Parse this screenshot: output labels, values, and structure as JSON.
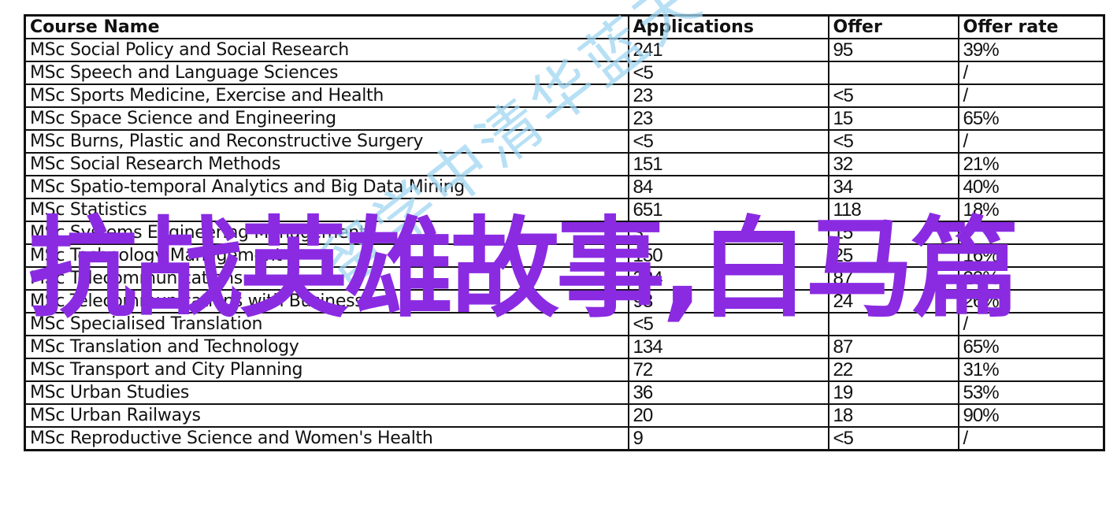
{
  "overlay": {
    "title": "抗战英雄故事,白马篇",
    "color": "#8a2be2"
  },
  "watermark": {
    "text": "留学中清华蓝天地",
    "color": "#9fd6f2"
  },
  "table": {
    "headers": [
      "Course Name",
      "Applications",
      "Offer",
      "Offer rate"
    ],
    "rows": [
      [
        "MSc Social Policy and Social Research",
        "241",
        "95",
        "39%"
      ],
      [
        "MSc Speech and Language Sciences",
        "<5",
        "",
        "/"
      ],
      [
        "MSc Sports Medicine, Exercise and Health",
        "23",
        "<5",
        "/"
      ],
      [
        "MSc Space Science and Engineering",
        "23",
        "15",
        "65%"
      ],
      [
        "MSc Burns, Plastic and Reconstructive Surgery",
        "<5",
        "<5",
        "/"
      ],
      [
        "MSc Social Research Methods",
        "151",
        "32",
        "21%"
      ],
      [
        "MSc Spatio-temporal Analytics and Big Data Mining",
        "84",
        "34",
        "40%"
      ],
      [
        "MSc Statistics",
        "651",
        "118",
        "18%"
      ],
      [
        "MSc Systems Engineering Management",
        "3",
        "15",
        ""
      ],
      [
        "MSc Technology Management",
        "150",
        "25",
        "16%"
      ],
      [
        "MSc Telecommunications",
        "384",
        "87",
        "23%"
      ],
      [
        "MSc Telecommunications with Business",
        "93",
        "24",
        "26%"
      ],
      [
        "MSc Specialised Translation",
        "<5",
        "",
        "/"
      ],
      [
        "MSc Translation and Technology",
        "134",
        "87",
        "65%"
      ],
      [
        "MSc Transport and City Planning",
        "72",
        "22",
        "31%"
      ],
      [
        "MSc Urban Studies",
        "36",
        "19",
        "53%"
      ],
      [
        "MSc Urban Railways",
        "20",
        "18",
        "90%"
      ],
      [
        "MSc Reproductive Science and Women's Health",
        "9",
        "<5",
        "/"
      ]
    ]
  }
}
